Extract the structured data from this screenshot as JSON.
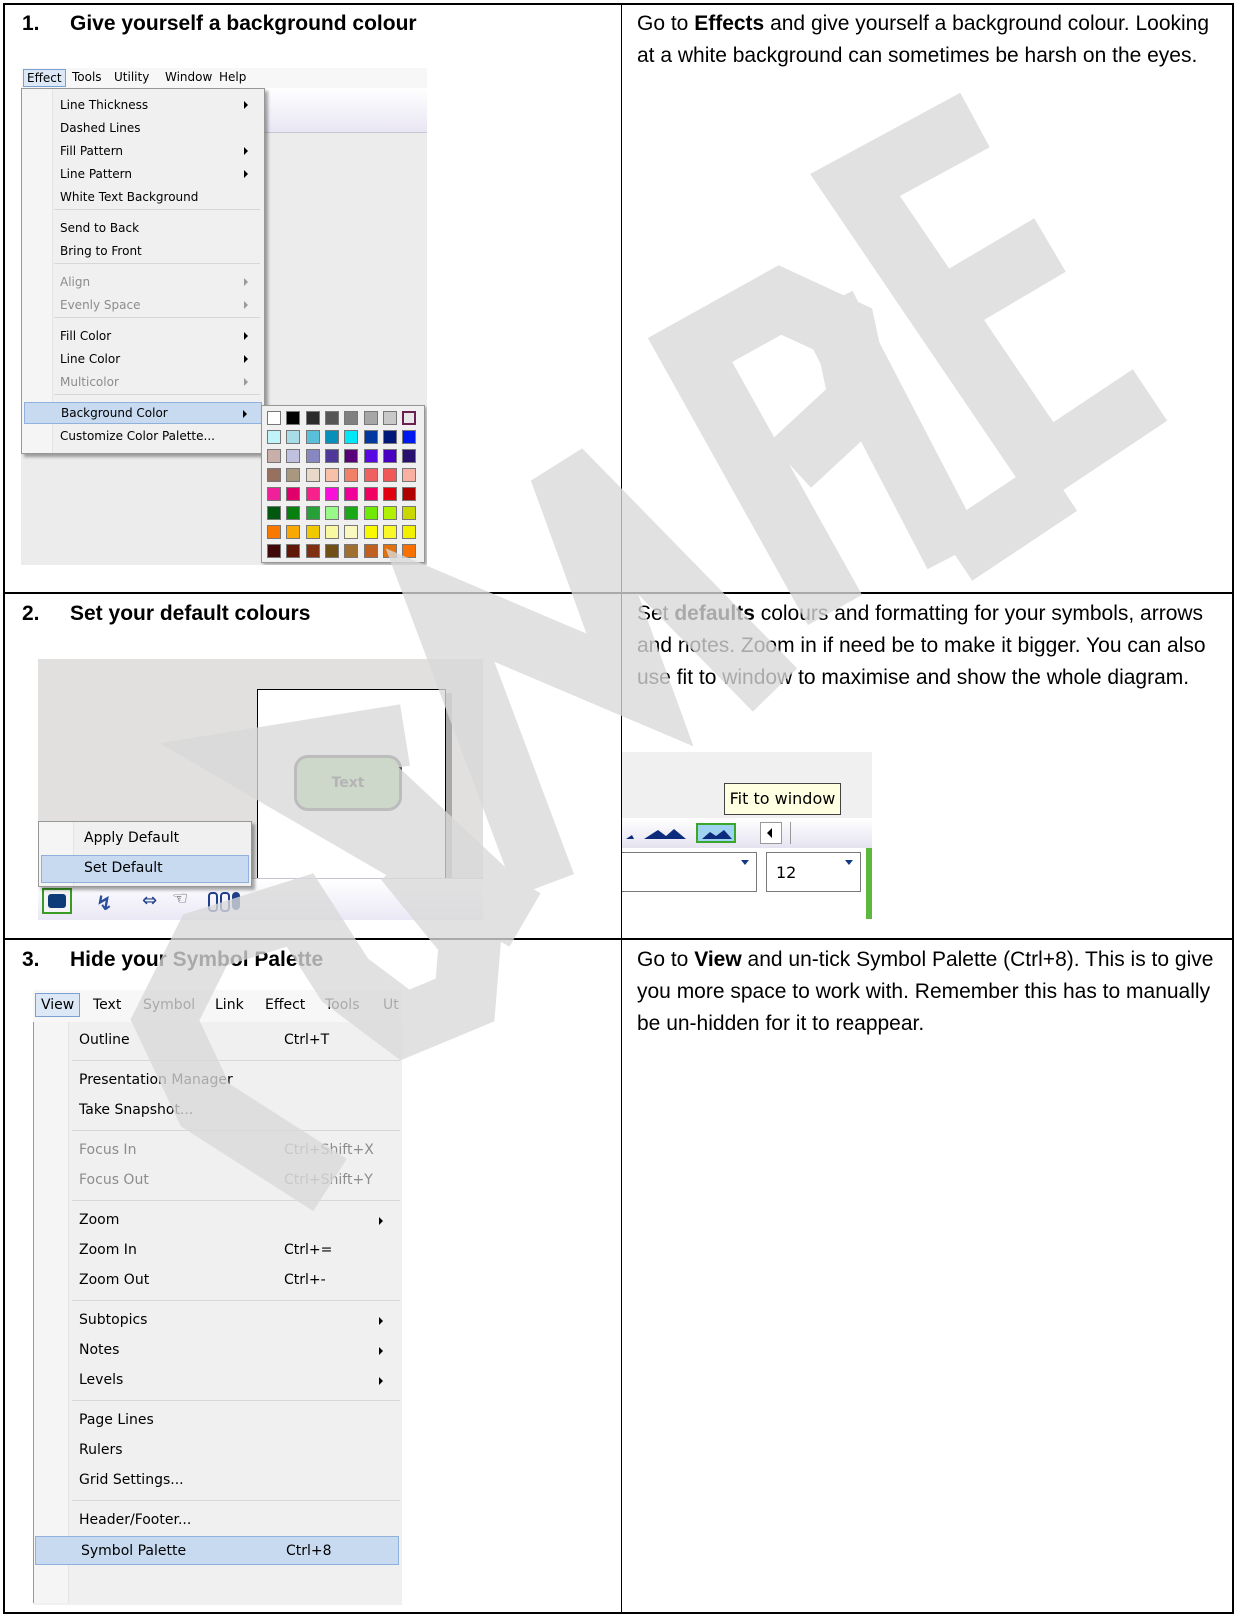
{
  "rows": [
    {
      "number": "1.",
      "heading": "Give yourself a background colour",
      "desc_parts": [
        "Go to ",
        "Effects",
        " and give yourself a background colour. Looking at a white background can sometimes be harsh on the eyes."
      ]
    },
    {
      "number": "2.",
      "heading": "Set your default colours",
      "desc_parts": [
        "Set ",
        "defaults",
        " colours and formatting for your symbols, arrows and notes. Zoom in if need be to make it bigger. You can also use fit to window to maximise and show the whole diagram."
      ]
    },
    {
      "number": "3.",
      "heading": "Hide your Symbol Palette",
      "desc_parts": [
        "Go to ",
        "View",
        " and un-tick Symbol Palette (Ctrl+8). This is to give you more space to work with. Remember this has to manually be un-hidden for it to reappear."
      ]
    }
  ],
  "effect_screenshot": {
    "menubar": [
      "Effect",
      "Tools",
      "Utility",
      "Window",
      "Help"
    ],
    "items": [
      {
        "label": "Line Thickness",
        "submenu": true,
        "disabled": false
      },
      {
        "label": "Dashed Lines",
        "submenu": false,
        "disabled": false
      },
      {
        "label": "Fill Pattern",
        "submenu": true,
        "disabled": false
      },
      {
        "label": "Line Pattern",
        "submenu": true,
        "disabled": false
      },
      {
        "label": "White Text Background",
        "submenu": false,
        "disabled": false
      },
      {
        "label": "Send to Back",
        "submenu": false,
        "disabled": false
      },
      {
        "label": "Bring to Front",
        "submenu": false,
        "disabled": false
      },
      {
        "label": "Align",
        "submenu": true,
        "disabled": true
      },
      {
        "label": "Evenly Space",
        "submenu": true,
        "disabled": true
      },
      {
        "label": "Fill Color",
        "submenu": true,
        "disabled": false
      },
      {
        "label": "Line Color",
        "submenu": true,
        "disabled": false
      },
      {
        "label": "Multicolor",
        "submenu": true,
        "disabled": true
      },
      {
        "label": "Background Color",
        "submenu": true,
        "disabled": false,
        "highlighted": true
      },
      {
        "label": "Customize Color Palette...",
        "submenu": false,
        "disabled": false
      }
    ],
    "palette": [
      [
        "#ffffff",
        "#000000",
        "#2b2b2b",
        "#555555",
        "#808080",
        "#a6a6a6",
        "#c8c8c8",
        "#e8e8e8"
      ],
      [
        "#c0f4f8",
        "#a8dde8",
        "#58c0d8",
        "#0890b8",
        "#00e8f8",
        "#0038a0",
        "#001878",
        "#0018f0"
      ],
      [
        "#c8b0a8",
        "#c0c0e0",
        "#8888c0",
        "#503898",
        "#580078",
        "#5808e0",
        "#4800c0",
        "#281070"
      ],
      [
        "#987060",
        "#a89880",
        "#e8d8c8",
        "#f8c0a8",
        "#f08068",
        "#f06060",
        "#f05858",
        "#f8b0a0"
      ],
      [
        "#f0209a",
        "#e0006a",
        "#f8208a",
        "#f810d8",
        "#f00098",
        "#f00060",
        "#e00010",
        "#b00000"
      ],
      [
        "#005810",
        "#088010",
        "#28a038",
        "#98f888",
        "#18a818",
        "#70e808",
        "#b0f000",
        "#c8d800"
      ],
      [
        "#f87800",
        "#f8a800",
        "#f0c800",
        "#f8f8a0",
        "#f8f8c0",
        "#f8f800",
        "#f8f828",
        "#f0f000"
      ],
      [
        "#400808",
        "#601808",
        "#803010",
        "#705018",
        "#a07030",
        "#c06020",
        "#e07010",
        "#f87000"
      ]
    ]
  },
  "defaults_screenshot": {
    "shape_text": "Text",
    "menu": [
      "Apply Default",
      "Set Default"
    ]
  },
  "fit_screenshot": {
    "tooltip": "Fit to window",
    "font_size": "12"
  },
  "view_screenshot": {
    "menubar": [
      "View",
      "Text",
      "Symbol",
      "Link",
      "Effect",
      "Tools",
      "Ut"
    ],
    "groups": [
      [
        {
          "label": "Outline",
          "shortcut": "Ctrl+T"
        }
      ],
      [
        {
          "label": "Presentation Manager",
          "shortcut": ""
        },
        {
          "label": "Take Snapshot...",
          "shortcut": ""
        }
      ],
      [
        {
          "label": "Focus In",
          "shortcut": "Ctrl+Shift+X",
          "disabled": true
        },
        {
          "label": "Focus Out",
          "shortcut": "Ctrl+Shift+Y",
          "disabled": true
        }
      ],
      [
        {
          "label": "Zoom",
          "submenu": true
        },
        {
          "label": "Zoom In",
          "shortcut": "Ctrl+="
        },
        {
          "label": "Zoom Out",
          "shortcut": "Ctrl+-"
        }
      ],
      [
        {
          "label": "Subtopics",
          "submenu": true
        },
        {
          "label": "Notes",
          "submenu": true
        },
        {
          "label": "Levels",
          "submenu": true
        }
      ],
      [
        {
          "label": "Page Lines",
          "shortcut": ""
        },
        {
          "label": "Rulers",
          "shortcut": ""
        },
        {
          "label": "Grid Settings...",
          "shortcut": ""
        }
      ],
      [
        {
          "label": "Header/Footer...",
          "shortcut": ""
        },
        {
          "label": "Symbol Palette",
          "shortcut": "Ctrl+8",
          "highlighted": true
        }
      ]
    ]
  },
  "watermark": "SAMPLE",
  "colors": {
    "menu_highlight": "#c7daf0",
    "shape_fill": "#a3d69b",
    "watermark": "#d9d9d9"
  }
}
